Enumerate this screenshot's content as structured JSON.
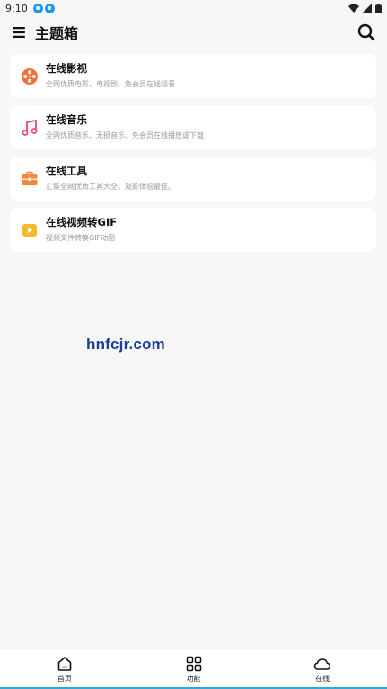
{
  "status_bar": {
    "time": "9:10"
  },
  "app_bar": {
    "title": "主题箱"
  },
  "cards": [
    {
      "title": "在线影视",
      "desc": "全网优质电影、电视剧、免会员在线观看",
      "icon": "film-reel-icon",
      "color": "#f2703a"
    },
    {
      "title": "在线音乐",
      "desc": "全网优质音乐、无损音乐、免会员在线播放或下载",
      "icon": "music-note-icon",
      "color": "#e84a7f"
    },
    {
      "title": "在线工具",
      "desc": "汇集全网优质工具大全，观影体验最佳。",
      "icon": "toolbox-icon",
      "color": "#f5863a"
    },
    {
      "title": "在线视频转GIF",
      "desc": "视频文件转换GIF动图",
      "icon": "video-play-icon",
      "color": "#f6b92b"
    }
  ],
  "watermark": {
    "text": "hnfcjr.com"
  },
  "bottom_nav": [
    {
      "label": "首页",
      "icon": "home-icon"
    },
    {
      "label": "功能",
      "icon": "grid-icon"
    },
    {
      "label": "在线",
      "icon": "cloud-icon"
    }
  ],
  "colors": {
    "nav_accent": "#2fa7d8",
    "watermark": "#1d3f9a"
  }
}
